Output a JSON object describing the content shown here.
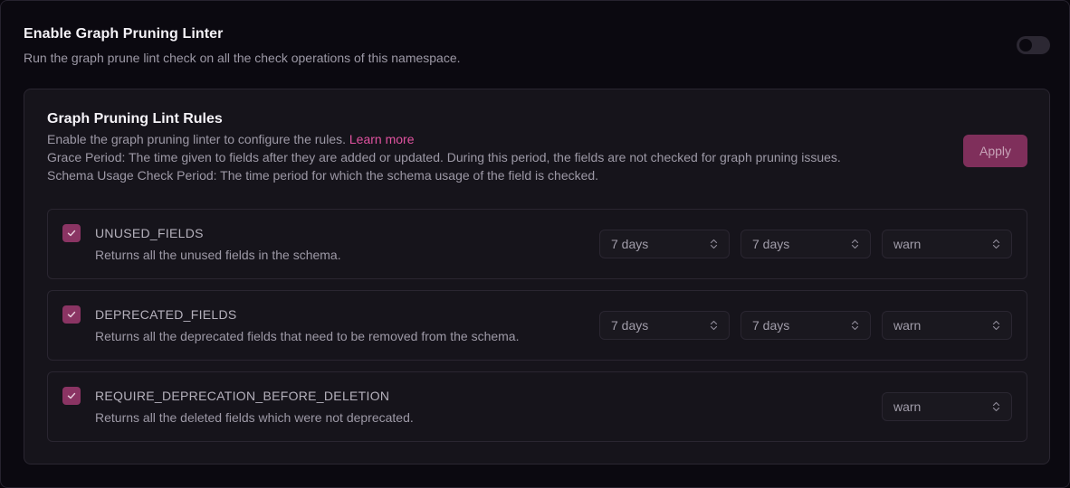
{
  "header": {
    "title": "Enable Graph Pruning Linter",
    "description": "Run the graph prune lint check on all the check operations of this namespace."
  },
  "card": {
    "title": "Graph Pruning Lint Rules",
    "intro": "Enable the graph pruning linter to configure the rules.",
    "learn_more": "Learn more",
    "grace_period": "Grace Period: The time given to fields after they are added or updated. During this period, the fields are not checked for graph pruning issues.",
    "usage_period": "Schema Usage Check Period: The time period for which the schema usage of the field is checked.",
    "apply_label": "Apply"
  },
  "rules": [
    {
      "name": "UNUSED_FIELDS",
      "description": "Returns all the unused fields in the schema.",
      "grace_period": "7 days",
      "usage_period": "7 days",
      "severity": "warn"
    },
    {
      "name": "DEPRECATED_FIELDS",
      "description": "Returns all the deprecated fields that need to be removed from the schema.",
      "grace_period": "7 days",
      "usage_period": "7 days",
      "severity": "warn"
    },
    {
      "name": "REQUIRE_DEPRECATION_BEFORE_DELETION",
      "description": "Returns all the deleted fields which were not deprecated.",
      "severity": "warn"
    }
  ],
  "colors": {
    "accent": "#e153a0",
    "checkbox": "#8a3463",
    "apply_bg": "#7f2f5b"
  },
  "icons": {
    "checkbox": "check-icon",
    "select": "chevron-up-down-icon"
  }
}
